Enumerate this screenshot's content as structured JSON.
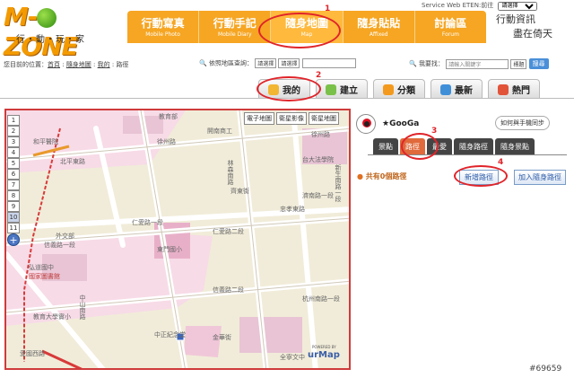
{
  "logo": {
    "text_left": "M-",
    "text_right": "ZONE",
    "tagline": "行・動・玩・家"
  },
  "topnav": [
    {
      "title": "行動寫真",
      "sub": "Mobile Photo"
    },
    {
      "title": "行動手記",
      "sub": "Mobile Diary"
    },
    {
      "title": "隨身地圖",
      "sub": "Map"
    },
    {
      "title": "隨身貼貼",
      "sub": "Affixed"
    },
    {
      "title": "討論區",
      "sub": "Forum"
    }
  ],
  "topright": {
    "label": "Service Web ETEN:前往",
    "select": "請選擇",
    "handwritten_1": "行動資訊",
    "handwritten_2": "盡在倚天"
  },
  "breadcrumb": {
    "prefix": "您目前的位置：",
    "home": "首頁",
    "map": "隨身地圖",
    "mine": "我的",
    "current": "路徑"
  },
  "search": {
    "region_label": "依照地區查詢：",
    "region_select1": "請選擇",
    "region_select2": "請選擇",
    "find_label": "我要找：",
    "find_placeholder": "請輸入關鍵字",
    "find_type": "標題",
    "go": "搜尋"
  },
  "tabs": [
    {
      "label": "我的",
      "color": "#f2b632"
    },
    {
      "label": "建立",
      "color": "#7ac14a"
    },
    {
      "label": "分類",
      "color": "#f39a1e"
    },
    {
      "label": "最新",
      "color": "#3f8fd8"
    },
    {
      "label": "熱門",
      "color": "#e2543a"
    }
  ],
  "annotations": [
    "1",
    "2",
    "3",
    "4"
  ],
  "map": {
    "zoom_levels": [
      "1",
      "2",
      "3",
      "4",
      "5",
      "6",
      "7",
      "8",
      "9",
      "10",
      "11"
    ],
    "zoom_plus": "+",
    "maptypes": [
      "電子地圖",
      "衛星影像",
      "衛星地圖"
    ],
    "logo_small": "POWERED BY",
    "logo": "urMap",
    "labels": [
      "教育部",
      "開南商工",
      "徐州路",
      "徐州路",
      "台大法學院",
      "和平醫院",
      "北平東路",
      "濟南路一段",
      "林森南路",
      "新生南路一段",
      "齊東街",
      "忠孝東路",
      "仁愛路一段",
      "仁愛路二段",
      "外交部",
      "東門國小",
      "信義路一段",
      "信義路二段",
      "杭州南路一段",
      "愛國西路",
      "中正紀念堂",
      "中山南路",
      "教育大學實小",
      "弘道國中",
      "國家圖書館",
      "金華街",
      "全寧文中"
    ]
  },
  "panel": {
    "user": "★GooGa",
    "sync": "如何與手機同步",
    "tabs": [
      "景點",
      "路徑",
      "最愛",
      "隨身路徑",
      "隨身景點"
    ],
    "count": "共有0個路徑",
    "new_path": "新增路徑",
    "add_path": "加入隨身路徑"
  },
  "watermark": "#69659"
}
